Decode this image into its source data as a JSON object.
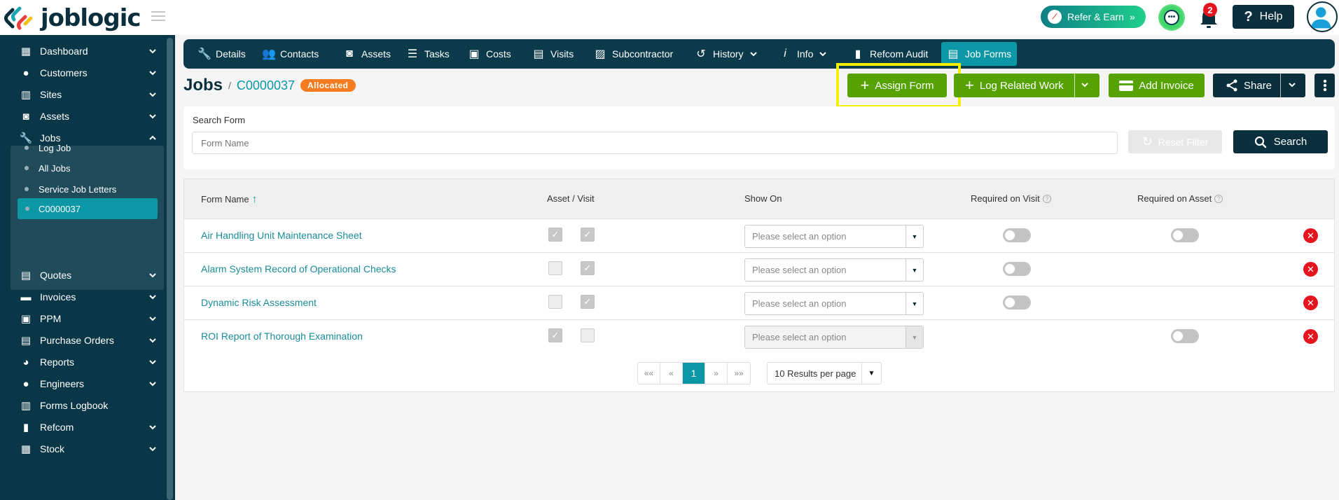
{
  "brand": {
    "name": "joblogic"
  },
  "topbar": {
    "refer_label": "Refer & Earn",
    "refer_chevron": "»",
    "notification_count": "2",
    "help_label": "Help",
    "help_glyph": "?"
  },
  "sidebar": {
    "items": [
      {
        "label": "Dashboard",
        "icon": "dashboard-icon",
        "glyph": "▦"
      },
      {
        "label": "Customers",
        "icon": "user-icon",
        "glyph": "●"
      },
      {
        "label": "Sites",
        "icon": "building-icon",
        "glyph": "▥"
      },
      {
        "label": "Assets",
        "icon": "washing-machine-icon",
        "glyph": "◙"
      },
      {
        "label": "Jobs",
        "icon": "wrench-icon",
        "glyph": "🔧"
      },
      {
        "label": "Quotes",
        "icon": "clipboard-icon",
        "glyph": "▤"
      },
      {
        "label": "Invoices",
        "icon": "credit-card-icon",
        "glyph": "▬"
      },
      {
        "label": "PPM",
        "icon": "calendar-check-icon",
        "glyph": "▣"
      },
      {
        "label": "Purchase Orders",
        "icon": "file-icon",
        "glyph": "▤"
      },
      {
        "label": "Reports",
        "icon": "pie-chart-icon",
        "glyph": "◕"
      },
      {
        "label": "Engineers",
        "icon": "users-icon",
        "glyph": "●"
      },
      {
        "label": "Forms Logbook",
        "icon": "book-icon",
        "glyph": "▥"
      },
      {
        "label": "Refcom",
        "icon": "cylinder-icon",
        "glyph": "▮"
      },
      {
        "label": "Stock",
        "icon": "warehouse-icon",
        "glyph": "▦"
      }
    ],
    "jobs_sub": [
      {
        "label": "Log Job"
      },
      {
        "label": "All Jobs"
      },
      {
        "label": "Service Job Letters"
      },
      {
        "label": "C0000037"
      }
    ]
  },
  "tabs": [
    {
      "label": "Details",
      "glyph": "🔧"
    },
    {
      "label": "Contacts",
      "glyph": "👥"
    },
    {
      "label": "Assets",
      "glyph": "◙"
    },
    {
      "label": "Tasks",
      "glyph": "☰"
    },
    {
      "label": "Costs",
      "glyph": "▣"
    },
    {
      "label": "Visits",
      "glyph": "▤"
    },
    {
      "label": "Subcontractor",
      "glyph": "▨"
    },
    {
      "label": "History",
      "glyph": "↺",
      "dropdown": "⌄"
    },
    {
      "label": "Info",
      "glyph": "i",
      "dropdown": "⌄"
    },
    {
      "label": "Refcom Audit",
      "glyph": "▮"
    },
    {
      "label": "Job Forms",
      "glyph": "▤"
    }
  ],
  "page": {
    "section": "Jobs",
    "separator": "/",
    "job_ref": "C0000037",
    "status": "Allocated",
    "status_color": "#f57c1f"
  },
  "actions": {
    "assign_form": "Assign Form",
    "log_related_work": "Log Related Work",
    "add_invoice": "Add Invoice",
    "share": "Share"
  },
  "search": {
    "label": "Search Form",
    "placeholder": "Form Name",
    "value": "",
    "reset_label": "Reset Filter",
    "search_label": "Search"
  },
  "table": {
    "headers": {
      "form_name": "Form Name",
      "asset_visit": "Asset / Visit",
      "show_on": "Show On",
      "required_visit": "Required on Visit",
      "required_asset": "Required on Asset"
    },
    "rows": [
      {
        "name": "Air Handling Unit Maintenance Sheet",
        "asset": true,
        "visit": true,
        "show_on": "Please select an option",
        "show_on_disabled": false,
        "req_visit_toggle": true,
        "req_visit_on": false,
        "req_asset_toggle": true,
        "req_asset_on": false
      },
      {
        "name": "Alarm System Record of Operational Checks",
        "asset": false,
        "visit": true,
        "show_on": "Please select an option",
        "show_on_disabled": false,
        "req_visit_toggle": true,
        "req_visit_on": false,
        "req_asset_toggle": false,
        "req_asset_on": false
      },
      {
        "name": "Dynamic Risk Assessment",
        "asset": false,
        "visit": true,
        "show_on": "Please select an option",
        "show_on_disabled": false,
        "req_visit_toggle": true,
        "req_visit_on": false,
        "req_asset_toggle": false,
        "req_asset_on": false
      },
      {
        "name": "ROI Report of Thorough Examination",
        "asset": true,
        "visit": false,
        "show_on": "Please select an option",
        "show_on_disabled": true,
        "req_visit_toggle": false,
        "req_visit_on": false,
        "req_asset_toggle": true,
        "req_asset_on": false
      }
    ]
  },
  "pagination": {
    "first": "««",
    "prev": "«",
    "current": "1",
    "next": "»",
    "last": "»»",
    "per_page": "10 Results per page"
  },
  "colors": {
    "sidebar_bg": "#0a3747",
    "accent": "#0b97a6",
    "green": "#55a202",
    "dark": "#0b2f3d",
    "danger": "#e5141f",
    "highlight": "#f3ef00"
  }
}
